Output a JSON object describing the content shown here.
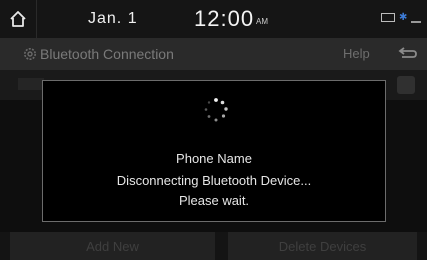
{
  "status": {
    "date": "Jan.  1",
    "time": "12:00",
    "ampm": "AM"
  },
  "header": {
    "title": "Bluetooth Connection",
    "help_label": "Help"
  },
  "footer": {
    "add_new_label": "Add New",
    "delete_devices_label": "Delete Devices"
  },
  "popup": {
    "device_name": "Phone Name",
    "message": "Disconnecting Bluetooth Device...",
    "wait_text": "Please wait."
  }
}
